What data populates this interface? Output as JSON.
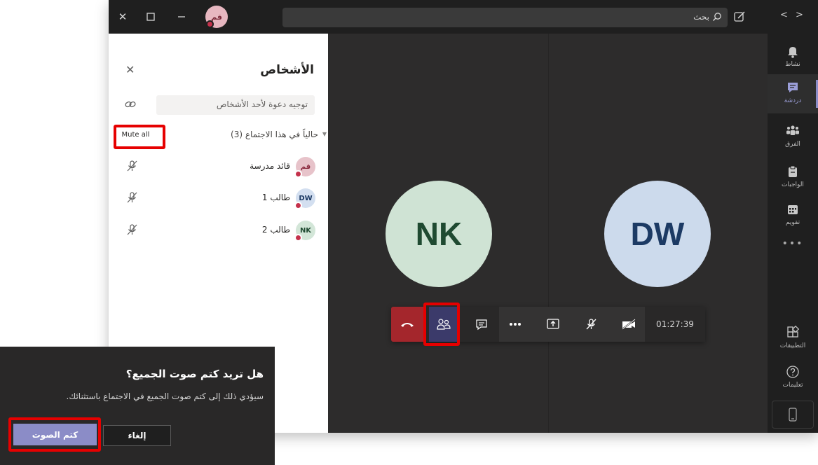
{
  "titlebar": {
    "avatar_initials": "قم",
    "search_label": "بحث"
  },
  "people_panel": {
    "title": "الأشخاص",
    "invite_placeholder": "توجيه دعوة لأحد الأشخاص",
    "section_label": "حالياً في هذا الاجتماع (3)",
    "mute_all_label": "Mute all",
    "participants": [
      {
        "initials": "قم",
        "name": "قائد مدرسة",
        "avatar_bg": "#e7c3ca",
        "avatar_fg": "#8a2a3f"
      },
      {
        "initials": "DW",
        "name": "طالب 1",
        "avatar_bg": "#d3dff0",
        "avatar_fg": "#1c3a64"
      },
      {
        "initials": "NK",
        "name": "طالب 2",
        "avatar_bg": "#d3e6d8",
        "avatar_fg": "#1f4a31"
      }
    ]
  },
  "stage": {
    "tiles": [
      {
        "initials": "NK"
      },
      {
        "initials": "DW"
      }
    ],
    "call_timer": "01:27:39"
  },
  "rail": {
    "items": [
      {
        "label": "نشاط",
        "icon": "bell-icon"
      },
      {
        "label": "دردشة",
        "icon": "chat-icon"
      },
      {
        "label": "الفرق",
        "icon": "teams-icon"
      },
      {
        "label": "الواجبات",
        "icon": "assignments-icon"
      },
      {
        "label": "تقويم",
        "icon": "calendar-icon"
      }
    ],
    "more": "•••",
    "apps_label": "التطبيقات",
    "help_label": "تعليمات"
  },
  "dialog": {
    "title": "هل تريد كتم صوت الجميع؟",
    "body": "سيؤدي ذلك إلى كتم صوت الجميع في الاجتماع باستثنائك.",
    "cancel_label": "إلغاء",
    "mute_label": "كتم الصوت"
  },
  "colors": {
    "accent": "#8b8cc7",
    "highlight": "#e60000",
    "hangup": "#a4262c",
    "status_busy": "#c4314b"
  }
}
